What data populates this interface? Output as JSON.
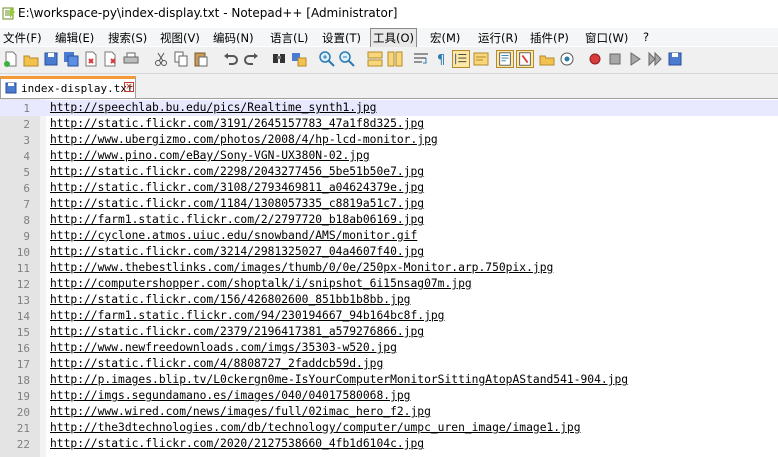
{
  "window": {
    "title": "E:\\workspace-py\\index-display.txt - Notepad++ [Administrator]"
  },
  "menu": {
    "items": [
      "文件(F)",
      "编辑(E)",
      "搜索(S)",
      "视图(V)",
      "编码(N)",
      "语言(L)",
      "设置(T)",
      "工具(O)",
      "宏(M)",
      "运行(R)",
      "插件(P)",
      "窗口(W)",
      "?"
    ],
    "active_index": 7
  },
  "toolbar": {
    "icons": [
      "new-file-icon",
      "open-file-icon",
      "save-icon",
      "save-all-icon",
      "close-icon",
      "close-all-icon",
      "print-icon",
      "cut-icon",
      "copy-icon",
      "paste-icon",
      "undo-icon",
      "redo-icon",
      "find-icon",
      "replace-icon",
      "zoom-in-icon",
      "zoom-out-icon",
      "sync-vertical-icon",
      "sync-horizontal-icon",
      "word-wrap-icon",
      "show-all-chars-icon",
      "indent-guide-icon",
      "user-lang-icon",
      "doc-map-icon",
      "function-list-icon",
      "folder-workspace-icon",
      "monitor-icon",
      "record-macro-icon",
      "stop-record-icon",
      "play-macro-icon",
      "run-macro-multiple-icon",
      "save-macro-icon"
    ]
  },
  "tab": {
    "label": "index-display.txt"
  },
  "editor": {
    "current_line": 1,
    "lines": [
      "http://speechlab.bu.edu/pics/Realtime_synth1.jpg",
      "http://static.flickr.com/3191/2645157783_47a1f8d325.jpg",
      "http://www.ubergizmo.com/photos/2008/4/hp-lcd-monitor.jpg",
      "http://www.pino.com/eBay/Sony-VGN-UX380N-02.jpg",
      "http://static.flickr.com/2298/2043277456_5be51b50e7.jpg",
      "http://static.flickr.com/3108/2793469811_a04624379e.jpg",
      "http://static.flickr.com/1184/1308057335_c8819a51c7.jpg",
      "http://farm1.static.flickr.com/2/2797720_b18ab06169.jpg",
      "http://cyclone.atmos.uiuc.edu/snowband/AMS/monitor.gif",
      "http://static.flickr.com/3214/2981325027_04a4607f40.jpg",
      "http://www.thebestlinks.com/images/thumb/0/0e/250px-Monitor.arp.750pix.jpg",
      "http://computershopper.com/shoptalk/i/snipshot_6i15nsag07m.jpg",
      "http://static.flickr.com/156/426802600_851bb1b8bb.jpg",
      "http://farm1.static.flickr.com/94/230194667_94b164bc8f.jpg",
      "http://static.flickr.com/2379/2196417381_a579276866.jpg",
      "http://www.newfreedownloads.com/imgs/35303-w520.jpg",
      "http://static.flickr.com/4/8808727_2faddcb59d.jpg",
      "http://p.images.blip.tv/L0ckergn0me-IsYourComputerMonitorSittingAtopAStand541-904.jpg",
      "http://imgs.segundamano.es/images/040/04017580068.jpg",
      "http://www.wired.com/news/images/full/02imac_hero_f2.jpg",
      "http://the3dtechnologies.com/db/technology/computer/umpc_uren_image/image1.jpg",
      "http://static.flickr.com/2020/2127538660_4fb1d6104c.jpg"
    ]
  }
}
